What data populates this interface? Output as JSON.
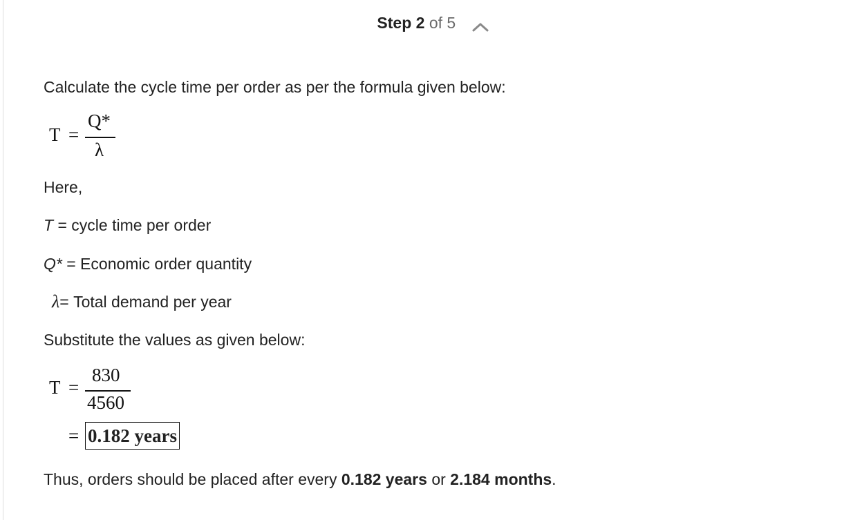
{
  "header": {
    "step_label": "Step 2",
    "of_label": "of 5",
    "collapse_icon": "chevron-up-icon"
  },
  "content": {
    "intro": "Calculate the cycle time per order as per the formula given below:",
    "formula1": {
      "lhs": "T",
      "equals": "=",
      "numerator": "Q*",
      "denominator": "λ"
    },
    "here": "Here,",
    "def1": {
      "symbol": "T",
      "text": " = cycle time per order"
    },
    "def2": {
      "symbol": "Q*",
      "text": " = Economic order quantity"
    },
    "def3": {
      "symbol": "λ",
      "text": "= Total demand per year"
    },
    "substitute": "Substitute the values as given below:",
    "formula2": {
      "lhs": "T",
      "equals": "=",
      "numerator": "830",
      "denominator": "4560",
      "equals2": "=",
      "result": "0.182 years"
    },
    "conclusion": {
      "prefix": "Thus, orders should be placed after every ",
      "value1": "0.182 years",
      "middle": " or ",
      "value2": "2.184 months",
      "suffix": "."
    }
  }
}
